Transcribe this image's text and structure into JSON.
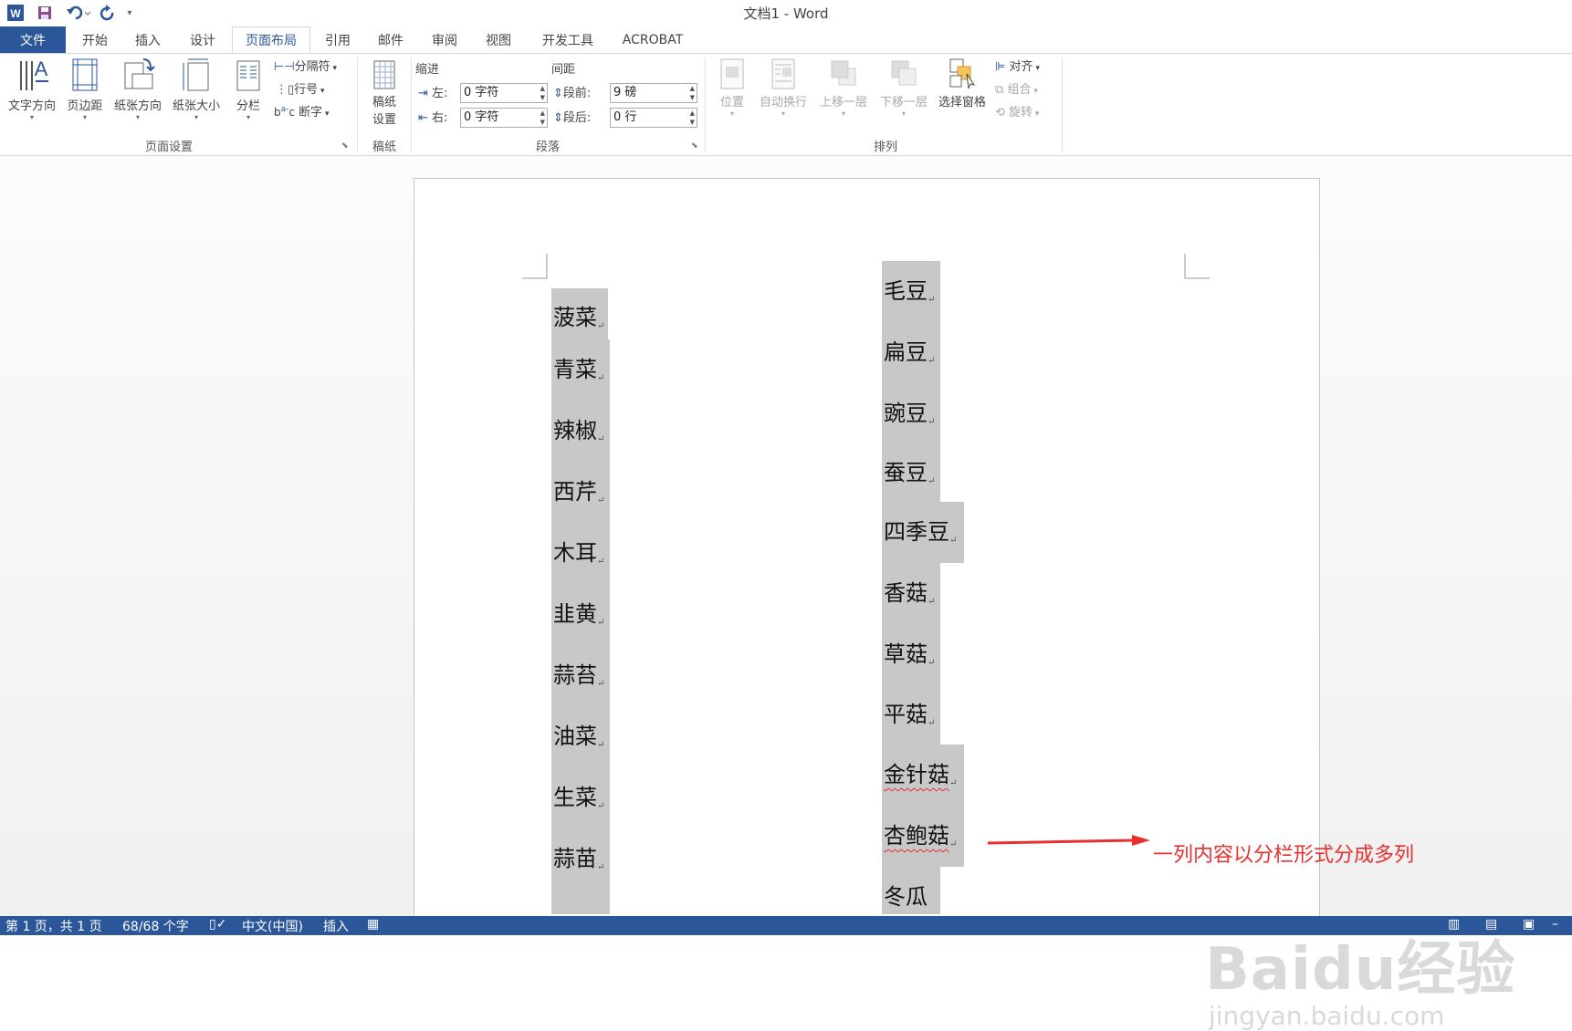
{
  "titlebar": {
    "title": "文档1 - Word"
  },
  "tabs": {
    "file": "文件",
    "items": [
      "开始",
      "插入",
      "设计",
      "页面布局",
      "引用",
      "邮件",
      "审阅",
      "视图",
      "开发工具",
      "ACROBAT"
    ],
    "active": "页面布局"
  },
  "ribbon": {
    "page_setup": {
      "text_direction": "文字方向",
      "margins": "页边距",
      "orientation": "纸张方向",
      "size": "纸张大小",
      "columns": "分栏",
      "breaks": "分隔符",
      "line_numbers": "行号",
      "hyphenation": "断字",
      "group_label": "页面设置"
    },
    "draft": {
      "button_line1": "稿纸",
      "button_line2": "设置",
      "group_label": "稿纸"
    },
    "paragraph": {
      "indent_label": "缩进",
      "spacing_label": "间距",
      "left_label": "左:",
      "right_label": "右:",
      "before_label": "段前:",
      "after_label": "段后:",
      "indent_left_value": "0 字符",
      "indent_right_value": "0 字符",
      "spacing_before_value": "9 磅",
      "spacing_after_value": "0 行",
      "group_label": "段落"
    },
    "arrange": {
      "position": "位置",
      "wrap_text": "自动换行",
      "bring_forward": "上移一层",
      "send_backward": "下移一层",
      "selection_pane": "选择窗格",
      "align": "对齐",
      "group": "组合",
      "rotate": "旋转",
      "group_label": "排列"
    }
  },
  "document": {
    "column1": [
      "菠菜",
      "青菜",
      "辣椒",
      "西芹",
      "木耳",
      "韭黄",
      "蒜苔",
      "油菜",
      "生菜",
      "蒜苗"
    ],
    "column2": [
      "毛豆",
      "扁豆",
      "豌豆",
      "蚕豆",
      "四季豆",
      "香菇",
      "草菇",
      "平菇",
      "金针菇",
      "杏鲍菇",
      "冬瓜"
    ],
    "paragraph_mark": "↵",
    "annotation": "一列内容以分栏形式分成多列",
    "annotation_color": "#e8312f",
    "watermark_main": "Baidu经验",
    "watermark_sub": "jingyan.baidu.com"
  },
  "statusbar": {
    "page": "第 1 页，共 1 页",
    "words": "68/68 个字",
    "language": "中文(中国)",
    "mode": "插入"
  },
  "colors": {
    "accent": "#2b579a",
    "highlight": "#c8c8c8"
  }
}
